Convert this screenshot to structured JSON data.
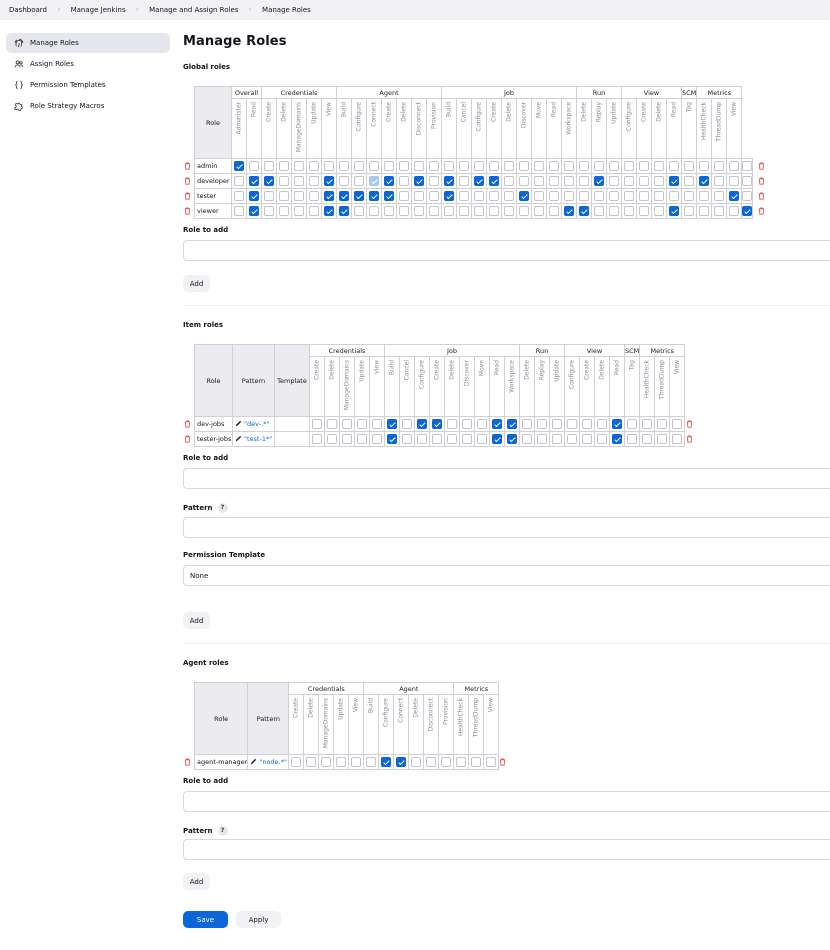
{
  "breadcrumb": [
    "Dashboard",
    "Manage Jenkins",
    "Manage and Assign Roles",
    "Manage Roles"
  ],
  "sidebar": {
    "items": [
      {
        "label": "Manage Roles",
        "icon": "fingerprint-icon",
        "active": true
      },
      {
        "label": "Assign Roles",
        "icon": "users-icon",
        "active": false
      },
      {
        "label": "Permission Templates",
        "icon": "braces-icon",
        "active": false
      },
      {
        "label": "Role Strategy Macros",
        "icon": "puzzle-icon",
        "active": false
      }
    ]
  },
  "page": {
    "title": "Manage Roles"
  },
  "global": {
    "title": "Global roles",
    "role_header": "Role",
    "groups": [
      {
        "name": "Overall",
        "perms": [
          "Administer",
          "Read"
        ]
      },
      {
        "name": "Credentials",
        "perms": [
          "Create",
          "Delete",
          "ManageDomains",
          "Update",
          "View"
        ]
      },
      {
        "name": "Agent",
        "perms": [
          "Build",
          "Configure",
          "Connect",
          "Create",
          "Delete",
          "Disconnect",
          "Provision"
        ]
      },
      {
        "name": "Job",
        "perms": [
          "Build",
          "Cancel",
          "Configure",
          "Create",
          "Delete",
          "Discover",
          "Move",
          "Read",
          "Workspace"
        ]
      },
      {
        "name": "Run",
        "perms": [
          "Delete",
          "Replay",
          "Update"
        ]
      },
      {
        "name": "View",
        "perms": [
          "Configure",
          "Create",
          "Delete",
          "Read"
        ]
      },
      {
        "name": "SCM",
        "perms": [
          "Tag"
        ]
      },
      {
        "name": "Metrics",
        "perms": [
          "HealthCheck",
          "ThreadDump",
          "View"
        ]
      }
    ],
    "rows": [
      {
        "name": "admin",
        "checks": [
          1,
          0,
          0,
          0,
          0,
          0,
          0,
          0,
          0,
          0,
          0,
          0,
          0,
          0,
          0,
          0,
          0,
          0,
          0,
          0,
          0,
          0,
          0,
          0,
          0,
          0,
          0,
          0,
          0,
          0,
          0,
          0,
          0,
          0,
          0
        ]
      },
      {
        "name": "developer",
        "checks": [
          0,
          1,
          1,
          0,
          0,
          0,
          1,
          0,
          0,
          2,
          1,
          0,
          1,
          0,
          1,
          0,
          1,
          1,
          0,
          0,
          0,
          0,
          0,
          0,
          1,
          0,
          0,
          0,
          0,
          1,
          0,
          1,
          0,
          0,
          0
        ]
      },
      {
        "name": "tester",
        "checks": [
          0,
          1,
          0,
          0,
          0,
          0,
          1,
          1,
          1,
          1,
          1,
          0,
          0,
          0,
          1,
          0,
          0,
          0,
          0,
          1,
          0,
          0,
          0,
          0,
          0,
          0,
          0,
          0,
          0,
          0,
          0,
          0,
          0,
          1,
          0
        ]
      },
      {
        "name": "viewer",
        "checks": [
          0,
          1,
          0,
          0,
          0,
          0,
          1,
          1,
          0,
          0,
          0,
          0,
          0,
          0,
          0,
          0,
          0,
          0,
          0,
          0,
          0,
          0,
          1,
          1,
          0,
          0,
          0,
          0,
          0,
          1,
          0,
          0,
          0,
          0,
          1
        ]
      }
    ],
    "role_to_add_label": "Role to add",
    "add_label": "Add"
  },
  "item": {
    "title": "Item roles",
    "headers": {
      "role": "Role",
      "pattern": "Pattern",
      "template": "Template"
    },
    "groups": [
      {
        "name": "Credentials",
        "perms": [
          "Create",
          "Delete",
          "ManageDomains",
          "Update",
          "View"
        ]
      },
      {
        "name": "Job",
        "perms": [
          "Build",
          "Cancel",
          "Configure",
          "Create",
          "Delete",
          "Discover",
          "Move",
          "Read",
          "Workspace"
        ]
      },
      {
        "name": "Run",
        "perms": [
          "Delete",
          "Replay",
          "Update"
        ]
      },
      {
        "name": "View",
        "perms": [
          "Configure",
          "Create",
          "Delete",
          "Read"
        ]
      },
      {
        "name": "SCM",
        "perms": [
          "Tag"
        ]
      },
      {
        "name": "Metrics",
        "perms": [
          "HealthCheck",
          "ThreadDump",
          "View"
        ]
      }
    ],
    "rows": [
      {
        "name": "dev-jobs",
        "pattern": "\"dev-.*\"",
        "checks": [
          0,
          0,
          0,
          0,
          0,
          1,
          0,
          1,
          1,
          0,
          0,
          0,
          1,
          1,
          0,
          0,
          0,
          0,
          0,
          0,
          1,
          0,
          0,
          0,
          0
        ]
      },
      {
        "name": "tester-jobs",
        "pattern": "\"test-1*\"",
        "checks": [
          0,
          0,
          0,
          0,
          0,
          1,
          0,
          0,
          0,
          0,
          0,
          0,
          1,
          1,
          0,
          0,
          0,
          0,
          0,
          0,
          1,
          0,
          0,
          0,
          0
        ]
      }
    ],
    "role_to_add_label": "Role to add",
    "pattern_label": "Pattern",
    "help_mark": "?",
    "permission_template_label": "Permission Template",
    "permission_template_value": "None",
    "add_label": "Add"
  },
  "agent": {
    "title": "Agent roles",
    "headers": {
      "role": "Role",
      "pattern": "Pattern"
    },
    "groups": [
      {
        "name": "Credentials",
        "perms": [
          "Create",
          "Delete",
          "ManageDomains",
          "Update",
          "View"
        ]
      },
      {
        "name": "Agent",
        "perms": [
          "Build",
          "Configure",
          "Connect",
          "Delete",
          "Disconnect",
          "Provision"
        ]
      },
      {
        "name": "Metrics",
        "perms": [
          "HealthCheck",
          "ThreadDump",
          "View"
        ]
      }
    ],
    "rows": [
      {
        "name": "agent-manager",
        "pattern": "\"node.*\"",
        "checks": [
          0,
          0,
          0,
          0,
          0,
          0,
          1,
          1,
          0,
          0,
          0,
          0,
          0,
          0
        ]
      }
    ],
    "role_to_add_label": "Role to add",
    "pattern_label": "Pattern",
    "help_mark": "?",
    "add_label": "Add"
  },
  "actions": {
    "save_label": "Save",
    "apply_label": "Apply"
  },
  "colors": {
    "accent": "#0a66d9",
    "delete": "#e5534b",
    "sidebar_active": "#e6e7ec"
  }
}
